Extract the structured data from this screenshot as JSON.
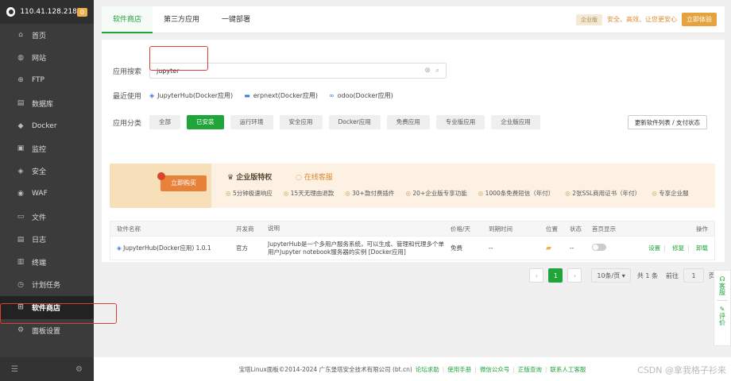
{
  "sidebar": {
    "ip": "110.41.128.218",
    "badge": "0",
    "items": [
      {
        "label": "首页",
        "icon": "home-icon"
      },
      {
        "label": "网站",
        "icon": "globe-icon"
      },
      {
        "label": "FTP",
        "icon": "ftp-icon"
      },
      {
        "label": "数据库",
        "icon": "database-icon"
      },
      {
        "label": "Docker",
        "icon": "docker-icon"
      },
      {
        "label": "监控",
        "icon": "monitor-icon"
      },
      {
        "label": "安全",
        "icon": "shield-icon"
      },
      {
        "label": "WAF",
        "icon": "waf-icon"
      },
      {
        "label": "文件",
        "icon": "folder-icon"
      },
      {
        "label": "日志",
        "icon": "log-icon"
      },
      {
        "label": "终端",
        "icon": "terminal-icon"
      },
      {
        "label": "计划任务",
        "icon": "clock-icon"
      },
      {
        "label": "软件商店",
        "icon": "apps-icon"
      },
      {
        "label": "面板设置",
        "icon": "gear-icon"
      }
    ]
  },
  "tabs": [
    "软件商店",
    "第三方应用",
    "一键部署"
  ],
  "promo": {
    "tag": "企业版",
    "text": "安全、高效、让您更安心",
    "button": "立即体验"
  },
  "search": {
    "label": "应用搜索",
    "value": "jupyter"
  },
  "recent": {
    "label": "最近使用",
    "items": [
      "JupyterHub(Docker应用)",
      "erpnext(Docker应用)",
      "odoo(Docker应用)"
    ]
  },
  "category": {
    "label": "应用分类",
    "items": [
      "全部",
      "已安装",
      "运行环境",
      "安全应用",
      "Docker应用",
      "免费应用",
      "专业版应用",
      "企业版应用"
    ],
    "update_button": "更新软件列表 / 支付状态"
  },
  "banner": {
    "buy": "立即购买",
    "title": "企业版特权",
    "service": "在线客服",
    "features": [
      "5分钟极速响应",
      "15天无理由退款",
      "30+款付费插件",
      "20+企业版专享功能",
      "1000条免费短信（年付）",
      "2张SSL商用证书（年付）",
      "专享企业服"
    ]
  },
  "table": {
    "headers": [
      "软件名称",
      "开发商",
      "说明",
      "价格/天",
      "到期时间",
      "位置",
      "状态",
      "首页显示",
      "操作"
    ],
    "row": {
      "name": "JupyterHub(Docker应用) 1.0.1",
      "vendor": "官方",
      "desc": "JupyterHub是一个多用户服务系统，可以生成、管理和代理多个单用户Jupyter notebook服务器的实例 [Docker应用]",
      "price": "免费",
      "expiry": "--",
      "status": "--",
      "ops": [
        "设置",
        "修复",
        "卸载"
      ]
    }
  },
  "pager": {
    "page": "1",
    "size": "10条/页",
    "total": "共 1 条",
    "goto": "前往",
    "goto_val": "1",
    "unit": "页"
  },
  "float": {
    "service": "客服",
    "review": "评价"
  },
  "footer": {
    "copyright": "宝塔Linux面板©2014-2024 广东堡塔安全技术有限公司 (bt.cn)",
    "links": [
      "论坛求助",
      "使用手册",
      "微信公众号",
      "正版查询",
      "联系人工客服"
    ]
  },
  "watermark": "CSDN @拿我格子衫来"
}
